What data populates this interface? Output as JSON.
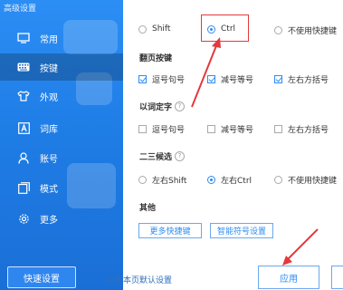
{
  "window": {
    "title": "高级设置"
  },
  "sidebar": {
    "items": [
      {
        "label": "常用",
        "icon": "monitor-icon"
      },
      {
        "label": "按键",
        "icon": "keyboard-icon"
      },
      {
        "label": "外观",
        "icon": "shirt-icon"
      },
      {
        "label": "词库",
        "icon": "letter-a-icon"
      },
      {
        "label": "账号",
        "icon": "user-icon"
      },
      {
        "label": "模式",
        "icon": "window-icon"
      },
      {
        "label": "更多",
        "icon": "gear-icon"
      }
    ],
    "active_index": 1,
    "quick_setting_label": "快速设置"
  },
  "main": {
    "top_radios": {
      "shift": "Shift",
      "ctrl": "Ctrl",
      "none": "不使用快捷键"
    },
    "page_keys": {
      "title": "翻页按键",
      "options": [
        {
          "label": "逗号句号",
          "checked": true
        },
        {
          "label": "减号等号",
          "checked": true
        },
        {
          "label": "左右方括号",
          "checked": true
        }
      ]
    },
    "word_select": {
      "title": "以词定字",
      "options": [
        {
          "label": "逗号句号",
          "checked": false
        },
        {
          "label": "减号等号",
          "checked": false
        },
        {
          "label": "左右方括号",
          "checked": false
        }
      ]
    },
    "candidate23": {
      "title": "二三候选",
      "options": [
        {
          "label": "左右Shift",
          "selected": false
        },
        {
          "label": "左右Ctrl",
          "selected": true
        },
        {
          "label": "不使用快捷键",
          "selected": false
        }
      ]
    },
    "other": {
      "title": "其他",
      "more_shortcuts": "更多快捷键",
      "smart_symbols": "智能符号设置"
    },
    "footer": {
      "restore_link": "恢复本页默认设置",
      "apply_label": "应用"
    }
  },
  "colors": {
    "accent": "#2d8cf0",
    "sidebar": "#1f7de6",
    "annotation": "#e4393c"
  }
}
